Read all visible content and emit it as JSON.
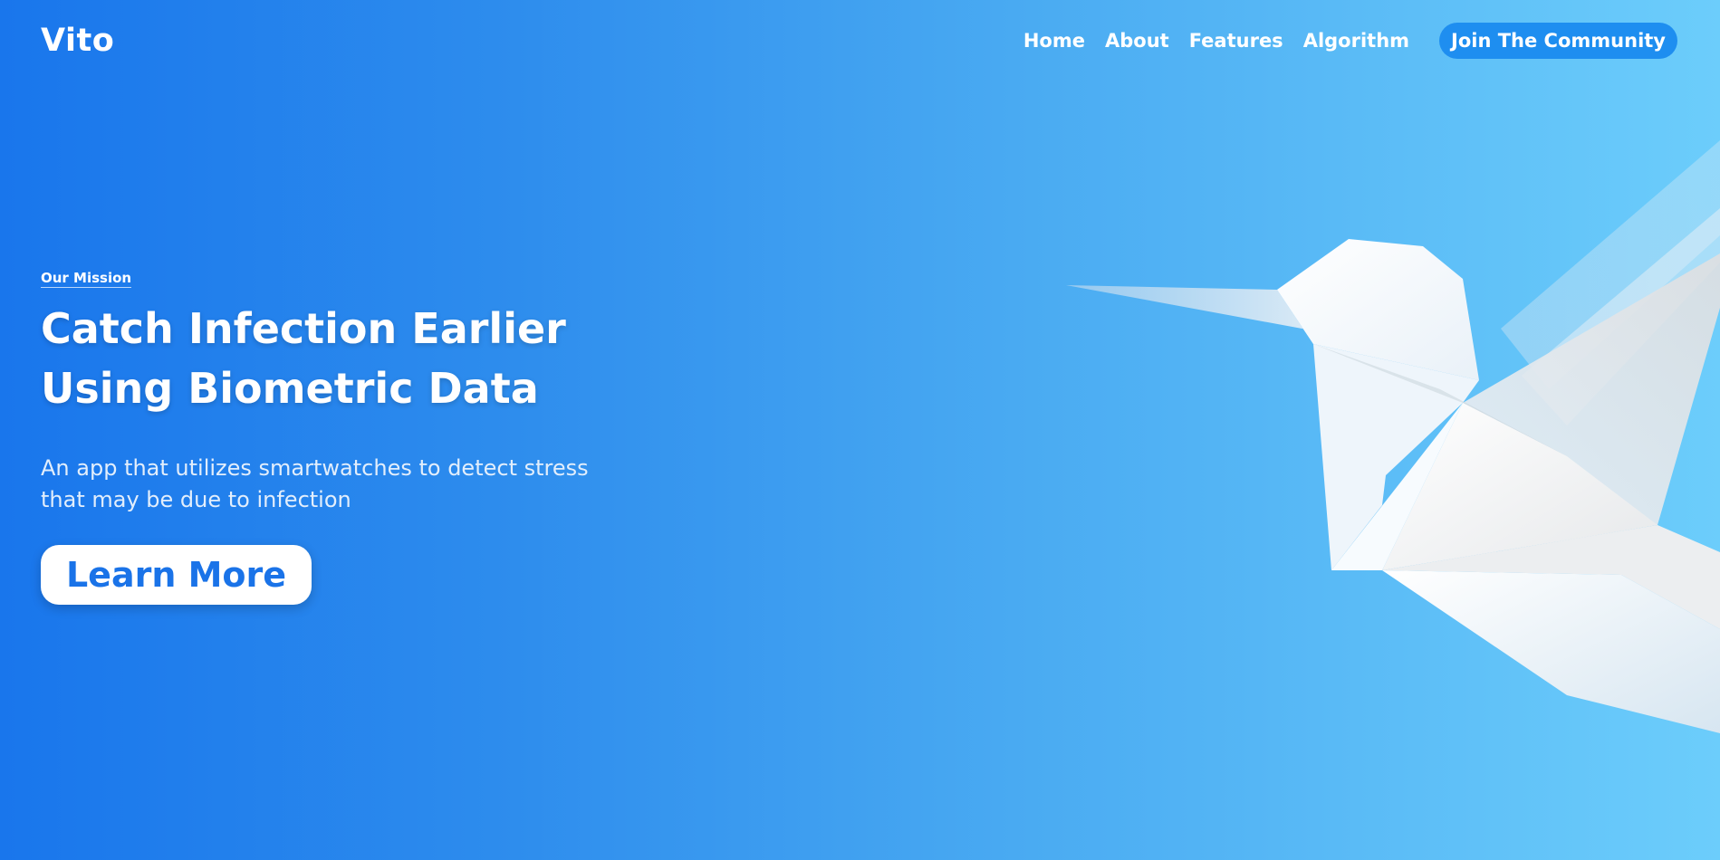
{
  "header": {
    "logo": "Vito",
    "nav": [
      {
        "label": "Home"
      },
      {
        "label": "About"
      },
      {
        "label": "Features"
      },
      {
        "label": "Algorithm"
      }
    ],
    "cta_label": "Join The Community"
  },
  "hero": {
    "eyebrow": "Our Mission",
    "headline_line1": "Catch Infection Earlier",
    "headline_line2": "Using Biometric Data",
    "subtext": "An app that utilizes smartwatches to detect stress that may be due to infection",
    "button_label": "Learn More"
  },
  "colors": {
    "gradient_start": "#1976ec",
    "gradient_end": "#6ccdfb",
    "accent": "#1a73e8",
    "cta_background": "#1e8ef0"
  },
  "illustration": {
    "icon": "origami-bird-icon"
  }
}
